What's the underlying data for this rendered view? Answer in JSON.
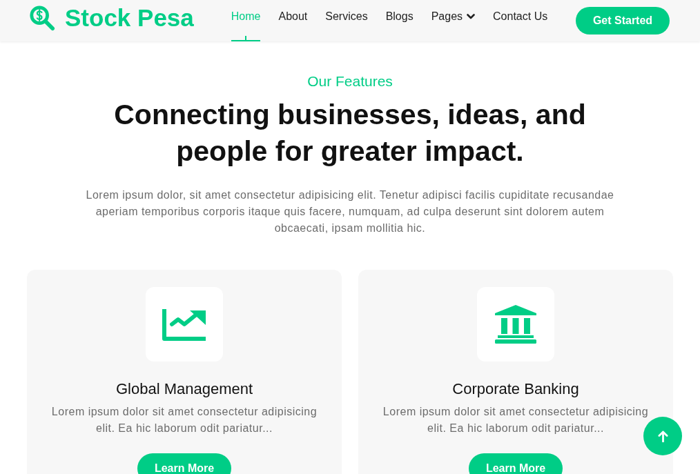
{
  "header": {
    "logo": "Stock Pesa",
    "nav": [
      {
        "label": "Home",
        "selected": true
      },
      {
        "label": "About",
        "selected": false
      },
      {
        "label": "Services",
        "selected": false
      },
      {
        "label": "Blogs",
        "selected": false
      },
      {
        "label": "Pages",
        "selected": false,
        "dropdown": true
      },
      {
        "label": "Contact Us",
        "selected": false
      }
    ],
    "cta": "Get Started"
  },
  "features": {
    "eyebrow": "Our Features",
    "heading": "Connecting businesses, ideas, and people for greater impact.",
    "description": "Lorem ipsum dolor, sit amet consectetur adipisicing elit. Tenetur adipisci facilis cupiditate recusandae aperiam temporibus corporis itaque quis facere, numquam, ad culpa deserunt sint dolorem autem obcaecati, ipsam mollitia hic.",
    "cards": [
      {
        "kind": "chart",
        "title": "Global Management",
        "text": "Lorem ipsum dolor sit amet consectetur adipisicing elit. Ea hic laborum odit pariatur...",
        "button": "Learn More"
      },
      {
        "kind": "bank",
        "title": "Corporate Banking",
        "text": "Lorem ipsum dolor sit amet consectetur adipisicing elit. Ea hic laborum odit pariatur...",
        "button": "Learn More"
      }
    ]
  }
}
